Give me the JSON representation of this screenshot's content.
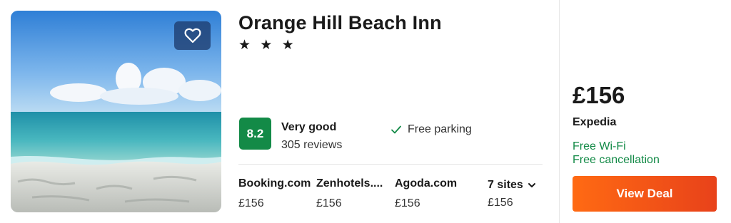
{
  "hotel": {
    "name": "Orange Hill Beach Inn",
    "stars": "★ ★ ★",
    "star_count": 3
  },
  "rating": {
    "score": "8.2",
    "label": "Very good",
    "reviews": "305 reviews",
    "color": "#138a47"
  },
  "amenity": {
    "icon": "check-icon",
    "label": "Free parking"
  },
  "sites": [
    {
      "name": "Booking.com",
      "price": "£156"
    },
    {
      "name": "Zenhotels....",
      "price": "£156"
    },
    {
      "name": "Agoda.com",
      "price": "£156"
    }
  ],
  "more_sites": {
    "label": "7 sites",
    "price": "£156",
    "icon": "chevron-down-icon"
  },
  "deal": {
    "price": "£156",
    "provider": "Expedia",
    "perks": [
      "Free Wi-Fi",
      "Free cancellation"
    ],
    "button_label": "View Deal",
    "button_color": "#f25a1e"
  },
  "favorite": {
    "icon": "heart-icon"
  }
}
